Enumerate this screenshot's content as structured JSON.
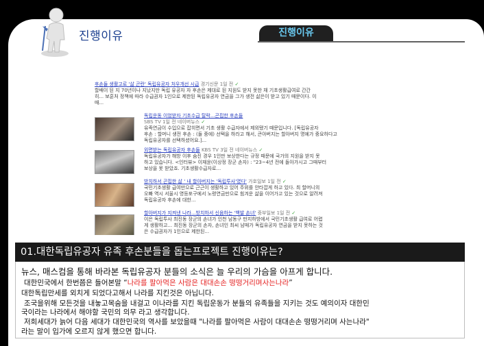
{
  "header": {
    "title": "진행이유",
    "tab_label": "진행이유"
  },
  "search_results": [
    {
      "title": "후손들 생활고로 '삶 곤란' 독립유공자 처우개선 시급",
      "source": "경기신문",
      "age": "1일 전",
      "snippet_lines": [
        "할배이 된 지 70년이나 지났지만 독립 유공자 자 후손은 제대로 된 지원도 받지 못한 채 기초생활급여로 간간",
        "히... 보훈처 정책에 따라 수급권자 1인으로 제한된 독립유공자 연금을 그가 생전 삶은이 받고 있기 때문이다. 이",
        "때..."
      ]
    },
    {
      "title": "독립운동 이었받자 기초수급 탈락...곤핍한 후손들",
      "source": "SBS TV",
      "age": "1일 전",
      "extra": "네이버뉴스",
      "snippet_lines": [
        "유족연금이 수입으로 잡히면서 기초 생활 수급자에서 제외됐기 때문입니다. [독립유공자",
        "후손 : 할머니 생전 후손 : (둘 중에) 선택을 하라고 해서, 큰아버지는 할아버지 명예가 중요하다고",
        "독립유공자를 선택하셨어요.]..."
      ]
    },
    {
      "title": "외면받는 독립유공자 후손들",
      "source": "KBS TV",
      "age": "3일 전",
      "extra": "네이버뉴스",
      "snippet_lines": [
        "독립유공자가 해방 이후 숨진 경우 1인만 보상한다는 규정 때문에 국가의 지원을 받지 못",
        "하고 있습니다. <인터뷰> 이재윤(이상정 장군 손자) : \"23~4년 전에 돌아가시고 그때부터",
        "보상을 못 받았죠. 기초생활수급자로..."
      ]
    },
    {
      "title": "방치하서 곤핍한 삶 ' 내 할아버지는 '독립투사'였다'",
      "source": "가호일보",
      "age": "1일 전",
      "snippet_lines": [
        "국민기초생활 급여만으로 근근이 생활하고 있어 주위를 안타깝게 하고 있다. 최 할머니의",
        "오빠 역시 서울시 영등포구에서 노령연금만으로 힘겨운 삶을 이어가고 있는 것으로 알려져",
        "독립유공자 후손에 대한..."
      ]
    },
    {
      "title": "할아버지가 지켜낸 나라...방치하서 신음하는 '백발 손녀'",
      "source": "중부일보",
      "age": "1일 전",
      "snippet_lines": [
        "이은 독립투사 최진동 장군의 손녀가 인천 남동구 만지하방에서 국민기초생활 급여로 어렵",
        "게 생활하고... 최진동 장군의 손자, 손녀인 최씨 남매가 독립유공자 연금을 받지 못하는 것",
        "은 수급권자가 1인으로 제한된..."
      ]
    }
  ],
  "question": "01.대한독립유공자 유족 후손분들을 돕는프로젝트 진행이유는?",
  "body": {
    "line1": "뉴스, 매스컴을 통해 바라본 독립유공자 분들의 소식은 늘 우리의 가슴을 아프게 합니다.",
    "line2_prefix": "대한민국에서 한번쯤은 들어본말 “",
    "line2_quote": "나라를 팔아먹은 사람은 대대손손 떵떵거리며사는나라",
    "line2_suffix": "”",
    "line3": "대한독립만세를 외치게 되었다고해서 나라를 지킨것은 아닙니다.",
    "line4": "조국을위해 모든것을 내놓고목숨을 내걸고 이나라를 지킨 독립운동가 분들의 유족들을 지키는 것도 예의이자 대한민",
    "line5": "국이라는 나라에서 해야할 국민의 의무 라고 생각합니다.",
    "line6": "저희세대가 늙어 다음 세대가 대한민국의 역사를 보았을때 \"나라를 팔아먹은 사람이 대대손손 떵떵거리며 사는나라\"",
    "line7": "라는 말이 입가에 오르지 않게 했으면 합니다."
  },
  "colors": {
    "accent_blue": "#1b3f8f",
    "tab_text": "#69c8ee",
    "quote_red": "#e52222"
  }
}
